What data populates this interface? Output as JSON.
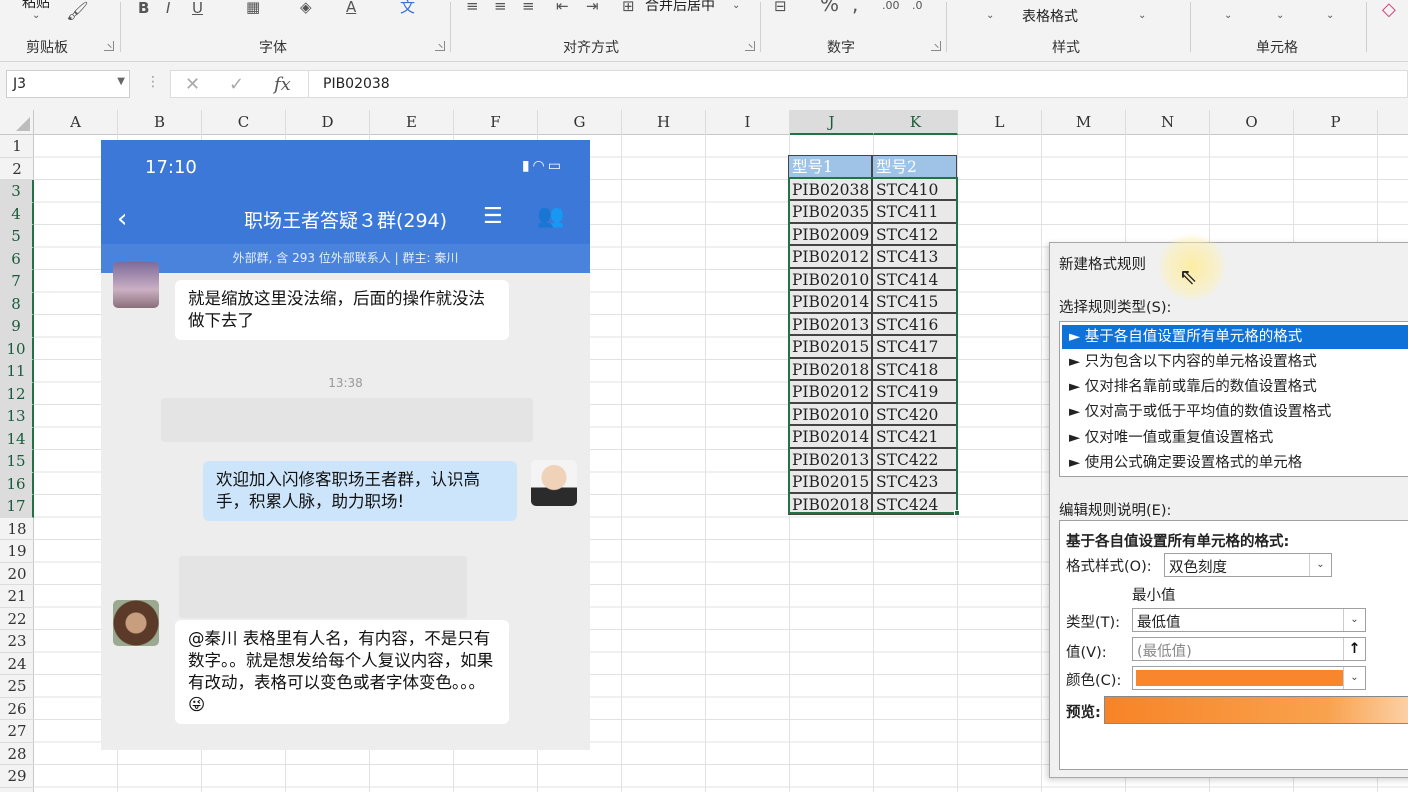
{
  "ribbon": {
    "paste_label": "粘贴",
    "merge_center_label": "合并后居中",
    "table_format_label": "表格格式",
    "groups": {
      "clipboard": "剪贴板",
      "font": "字体",
      "alignment": "对齐方式",
      "number": "数字",
      "styles": "样式",
      "cells": "单元格"
    }
  },
  "formula_bar": {
    "name_box": "J3",
    "formula": "PIB02038"
  },
  "grid": {
    "columns": [
      "A",
      "B",
      "C",
      "D",
      "E",
      "F",
      "G",
      "H",
      "I",
      "J",
      "K",
      "L",
      "M",
      "N",
      "O",
      "P"
    ],
    "rows": [
      "1",
      "2",
      "3",
      "4",
      "5",
      "6",
      "7",
      "8",
      "9",
      "10",
      "11",
      "12",
      "13",
      "14",
      "15",
      "16",
      "17",
      "18",
      "19",
      "20",
      "21",
      "22",
      "23",
      "24",
      "25",
      "26",
      "27",
      "28",
      "29"
    ],
    "selected_columns": [
      "J",
      "K"
    ],
    "table_headers": [
      "型号1",
      "型号2"
    ],
    "table_rows": [
      [
        "PIB02038",
        "STC410"
      ],
      [
        "PIB02035",
        "STC411"
      ],
      [
        "PIB02009",
        "STC412"
      ],
      [
        "PIB02012",
        "STC413"
      ],
      [
        "PIB02010",
        "STC414"
      ],
      [
        "PIB02014",
        "STC415"
      ],
      [
        "PIB02013",
        "STC416"
      ],
      [
        "PIB02015",
        "STC417"
      ],
      [
        "PIB02018",
        "STC418"
      ],
      [
        "PIB02012",
        "STC419"
      ],
      [
        "PIB02010",
        "STC420"
      ],
      [
        "PIB02014",
        "STC421"
      ],
      [
        "PIB02013",
        "STC422"
      ],
      [
        "PIB02015",
        "STC423"
      ],
      [
        "PIB02018",
        "STC424"
      ]
    ]
  },
  "chat": {
    "time": "17:10",
    "title": "职场王者答疑３群(294)",
    "subtitle": "外部群, 含 293 位外部联系人 | 群主: 秦川",
    "timestamp": "13:38",
    "messages": [
      {
        "text": "就是缩放这里没法缩，后面的操作就没法做下去了"
      },
      {
        "text": "欢迎加入闪修客职场王者群，认识高手，积累人脉，助力职场!"
      },
      {
        "text": "@秦川 表格里有人名，有内容，不是只有数字。。就是想发给每个人复议内容，如果有改动，表格可以变色或者字体变色。。。😜"
      }
    ]
  },
  "dialog": {
    "title": "新建格式规则",
    "rule_type_label": "选择规则类型(S):",
    "rule_types": [
      "► 基于各自值设置所有单元格的格式",
      "► 只为包含以下内容的单元格设置格式",
      "► 仅对排名靠前或靠后的数值设置格式",
      "► 仅对高于或低于平均值的数值设置格式",
      "► 仅对唯一值或重复值设置格式",
      "► 使用公式确定要设置格式的单元格"
    ],
    "edit_label": "编辑规则说明(E):",
    "edit_heading": "基于各自值设置所有单元格的格式:",
    "format_style_label": "格式样式(O):",
    "format_style_value": "双色刻度",
    "min_label": "最小值",
    "type_label": "类型(T):",
    "type_value": "最低值",
    "value_label": "值(V):",
    "value_placeholder": "(最低值)",
    "color_label": "颜色(C):",
    "color_value": "#f8862c",
    "preview_label": "预览:"
  },
  "colors": {
    "excel_green": "#217346",
    "table_header": "#9ec3e6",
    "chat_blue": "#3b78d8",
    "selection_blue": "#0f72d9"
  }
}
